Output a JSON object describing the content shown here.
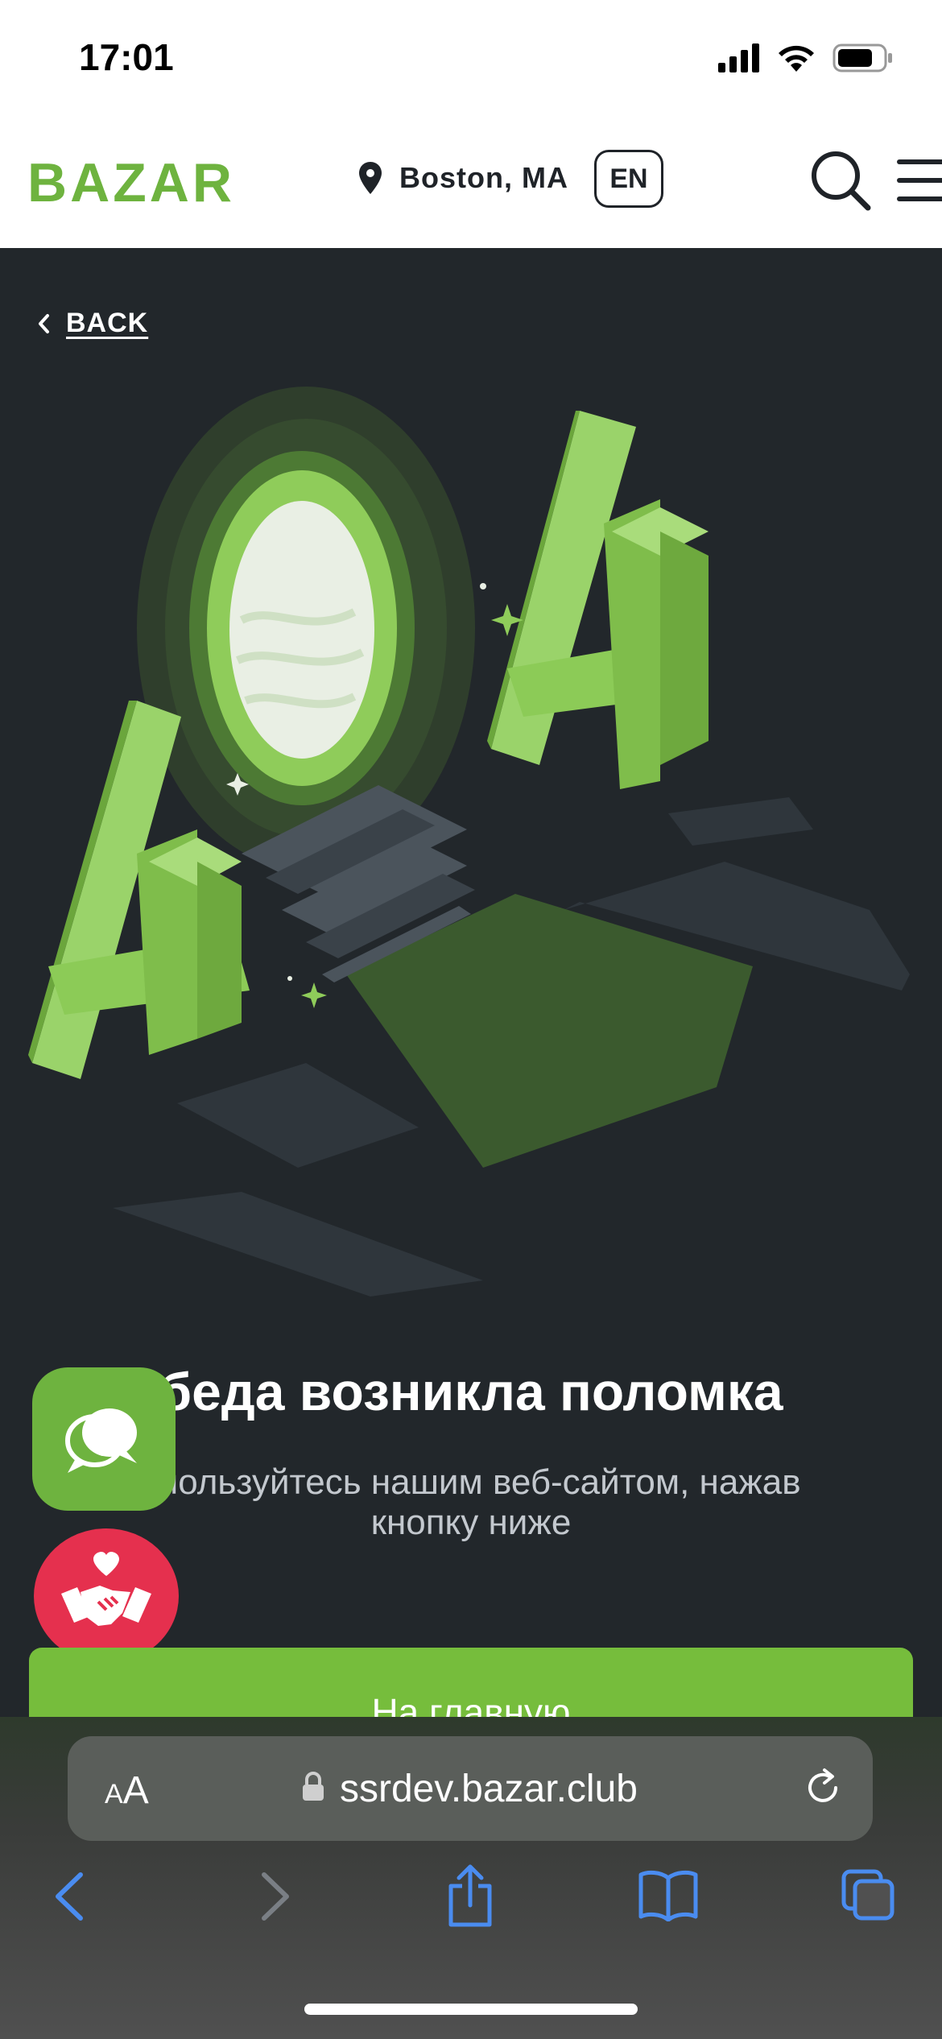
{
  "status_bar": {
    "time": "17:01"
  },
  "header": {
    "logo": "BAZAR",
    "location": "Boston, MA",
    "language": "EN"
  },
  "nav": {
    "back_label": "BACK"
  },
  "error": {
    "title": "беда возникла поломка",
    "subtitle_line1": "спользуйтесь нашим веб-сайтом, нажав",
    "subtitle_line2": "кнопку ниже",
    "home_button": "На главную"
  },
  "browser": {
    "text_size_small": "A",
    "text_size_large": "A",
    "url": "ssrdev.bazar.club"
  },
  "colors": {
    "brand_green": "#6eb33f",
    "page_bg": "#22272b",
    "charity_red": "#e5304e"
  }
}
